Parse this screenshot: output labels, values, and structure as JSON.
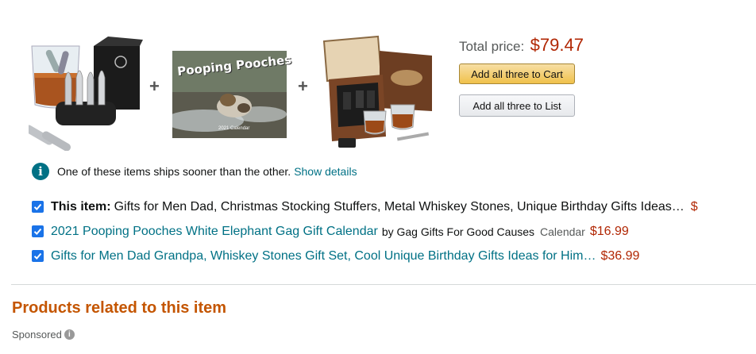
{
  "bundle": {
    "products": [
      {
        "name": "whiskey-stones-set-image"
      },
      {
        "name": "pooping-pooches-calendar-image",
        "cover_title": "Pooping Pooches",
        "cover_caption": "2021 Calendar"
      },
      {
        "name": "whiskey-gift-box-image"
      }
    ],
    "plus_symbol": "+",
    "total_label": "Total price:",
    "total_value": "$79.47",
    "add_cart_label": "Add all three to Cart",
    "add_list_label": "Add all three to List"
  },
  "notice": {
    "icon": "info-icon",
    "text": "One of these items ships sooner than the other.",
    "link": "Show details"
  },
  "items": [
    {
      "checked": true,
      "prefix": "This item:",
      "title": "Gifts for Men Dad, Christmas Stocking Stuffers, Metal Whiskey Stones, Unique Birthday Gifts Ideas…",
      "trailing": "$"
    },
    {
      "checked": true,
      "title": "2021 Pooping Pooches White Elephant Gag Gift Calendar",
      "by": "by Gag Gifts For Good Causes",
      "format": "Calendar",
      "price": "$16.99"
    },
    {
      "checked": true,
      "title": "Gifts for Men Dad Grandpa, Whiskey Stones Gift Set, Cool Unique Birthday Gifts Ideas for Him…",
      "price": "$36.99"
    }
  ],
  "related": {
    "title": "Products related to this item",
    "sponsored": "Sponsored",
    "sponsored_icon": "i"
  },
  "colors": {
    "price": "#b12704",
    "link": "#007185",
    "heading": "#c45500",
    "cart_button": "#f0c14b"
  }
}
